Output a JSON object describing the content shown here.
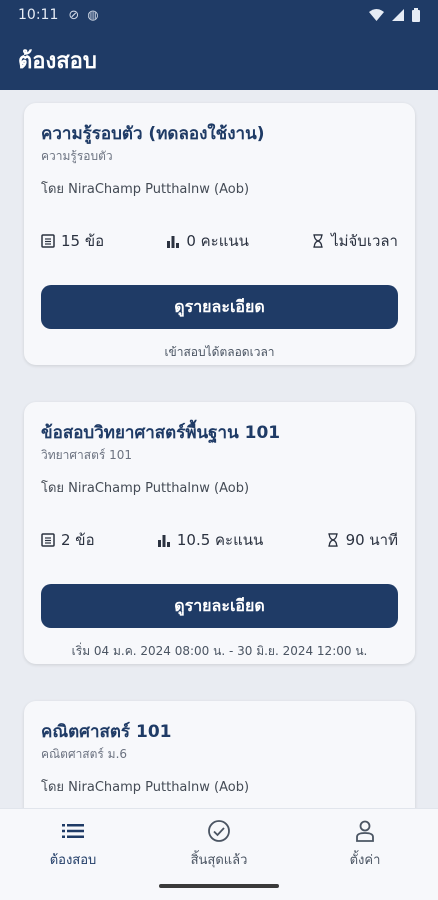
{
  "status_bar": {
    "time": "10:11"
  },
  "app_bar": {
    "title": "ต้องสอบ"
  },
  "exams": [
    {
      "title": "ความรู้รอบตัว (ทดลองใช้งาน)",
      "subject": "ความรู้รอบตัว",
      "author": "โดย NiraChamp Putthalnw (Aob)",
      "questions": "15 ข้อ",
      "score": "0 คะแนน",
      "time": "ไม่จับเวลา",
      "button_label": "ดูรายละเอียด",
      "note": "เข้าสอบได้ตลอดเวลา"
    },
    {
      "title": "ข้อสอบวิทยาศาสตร์พื้นฐาน 101",
      "subject": "วิทยาศาสตร์ 101",
      "author": "โดย NiraChamp Putthalnw (Aob)",
      "questions": "2 ข้อ",
      "score": "10.5 คะแนน",
      "time": "90 นาที",
      "button_label": "ดูรายละเอียด",
      "note": "เริ่ม 04 ม.ค. 2024 08:00 น. - 30 มิ.ย. 2024 12:00 น."
    },
    {
      "title": "คณิตศาสตร์ 101",
      "subject": "คณิตศาสตร์ ม.6",
      "author": "โดย NiraChamp Putthalnw (Aob)"
    }
  ],
  "bottom_nav": {
    "items": [
      {
        "label": "ต้องสอบ",
        "icon": "list-icon",
        "active": true
      },
      {
        "label": "สิ้นสุดแล้ว",
        "icon": "check-circle-icon",
        "active": false
      },
      {
        "label": "ตั้งค่า",
        "icon": "person-icon",
        "active": false
      }
    ]
  },
  "colors": {
    "primary": "#1f3b66",
    "background": "#e9ecf2",
    "card": "#f7f8fb"
  }
}
